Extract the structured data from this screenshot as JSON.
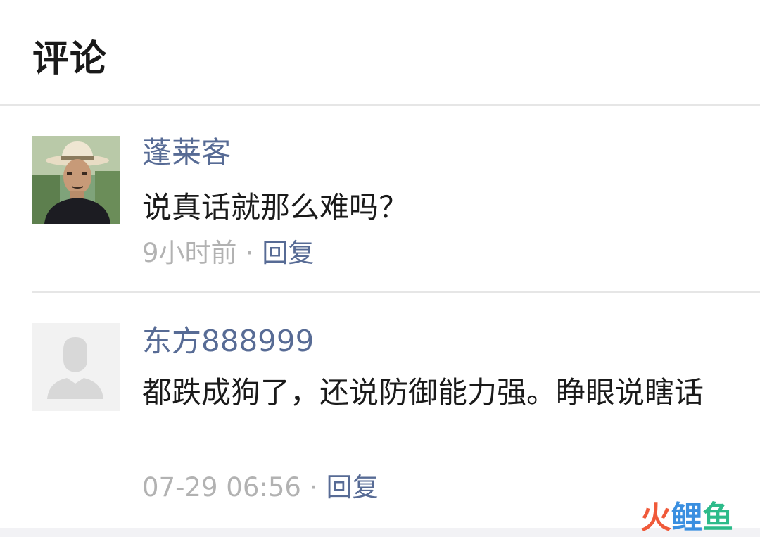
{
  "header": {
    "title": "评论"
  },
  "comments": [
    {
      "nickname": "蓬莱客",
      "content": "说真话就那么难吗？",
      "time": "9小时前",
      "separator": "·",
      "reply_label": "回复",
      "avatar_icon": "user-photo-avatar"
    },
    {
      "nickname": "东方888999",
      "content": "都跌成狗了，还说防御能力强。睁眼说瞎话",
      "time": "07-29 06:56",
      "separator": "·",
      "reply_label": "回复",
      "avatar_icon": "default-avatar-icon"
    }
  ],
  "watermark": {
    "chars": [
      "火",
      "鲤",
      "鱼"
    ],
    "colors": [
      "#f05a3a",
      "#3a8fe0",
      "#2dbb8a"
    ]
  },
  "colors": {
    "link": "#576b95",
    "meta": "#b2b2b2",
    "text": "#1a1a1a"
  }
}
